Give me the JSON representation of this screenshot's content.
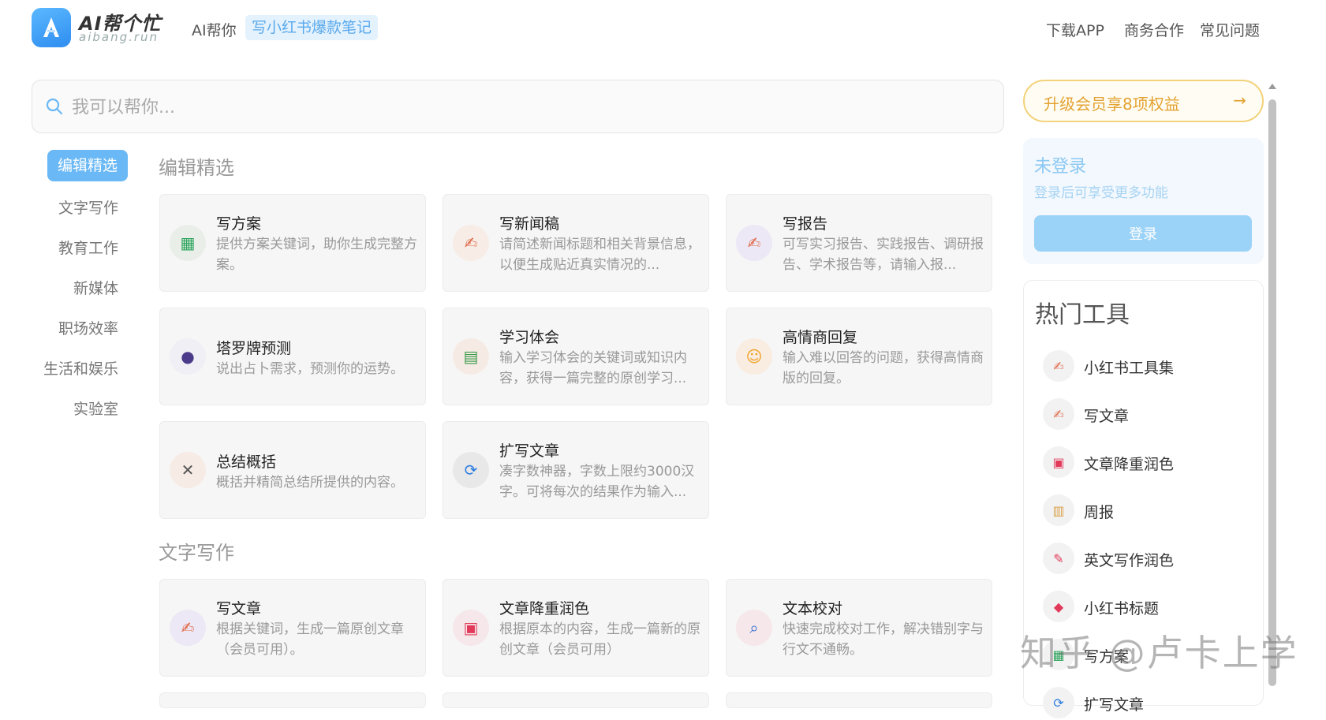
{
  "header": {
    "brand_title": "AI帮个忙",
    "brand_sub": "aibang.run",
    "help_text": "AI帮你",
    "help_tag": "写小红书爆款笔记",
    "nav": [
      "下载APP",
      "商务合作",
      "常见问题"
    ]
  },
  "search": {
    "placeholder": "我可以帮你..."
  },
  "categories": [
    "编辑精选",
    "文字写作",
    "教育工作",
    "新媒体",
    "职场效率",
    "生活和娱乐",
    "实验室"
  ],
  "sections": [
    {
      "title": "编辑精选",
      "cards": [
        {
          "title": "写方案",
          "desc": "提供方案关键词，助你生成完整方案。",
          "icon": "spreadsheet-icon"
        },
        {
          "title": "写新闻稿",
          "desc": "请简述新闻标题和相关背景信息，以便生成贴近真实情况的...",
          "icon": "writing-hand-icon"
        },
        {
          "title": "写报告",
          "desc": "可写实习报告、实践报告、调研报告、学术报告等，请输入报...",
          "icon": "writing-hand-icon"
        },
        {
          "title": "塔罗牌预测",
          "desc": "说出占卜需求，预测你的运势。",
          "icon": "crystal-ball-icon"
        },
        {
          "title": "学习体会",
          "desc": "输入学习体会的关键词或知识内容，获得一篇完整的原创学习...",
          "icon": "books-icon"
        },
        {
          "title": "高情商回复",
          "desc": "输入难以回答的问题，获得高情商版的回复。",
          "icon": "smile-icon"
        },
        {
          "title": "总结概括",
          "desc": "概括并精简总结所提供的内容。",
          "icon": "telescope-icon"
        },
        {
          "title": "扩写文章",
          "desc": "凑字数神器，字数上限约3000汉字。可将每次的结果作为输入...",
          "icon": "refresh-icon"
        }
      ]
    },
    {
      "title": "文字写作",
      "cards": [
        {
          "title": "写文章",
          "desc": "根据关键词，生成一篇原创文章（会员可用）。",
          "icon": "writing-hand-icon"
        },
        {
          "title": "文章降重润色",
          "desc": "根据原本的内容，生成一篇新的原创文章（会员可用）",
          "icon": "stamp-icon"
        },
        {
          "title": "文本校对",
          "desc": "快速完成校对工作，解决错别字与行文不通畅。",
          "icon": "magnifier-icon"
        }
      ]
    }
  ],
  "sidebar": {
    "upgrade_label": "升级会员享8项权益",
    "login_status": "未登录",
    "login_hint": "登录后可享受更多功能",
    "login_button": "登录",
    "hot_title": "热门工具",
    "hot_tools": [
      {
        "label": "小红书工具集",
        "icon": "writing-hand-icon"
      },
      {
        "label": "写文章",
        "icon": "writing-hand-icon"
      },
      {
        "label": "文章降重润色",
        "icon": "stamp-icon"
      },
      {
        "label": "周报",
        "icon": "scroll-icon"
      },
      {
        "label": "英文写作润色",
        "icon": "pencil-icon"
      },
      {
        "label": "小红书标题",
        "icon": "tag-icon"
      },
      {
        "label": "写方案",
        "icon": "spreadsheet-icon"
      },
      {
        "label": "扩写文章",
        "icon": "refresh-icon"
      }
    ]
  },
  "watermark": "知乎 @卢卡上学"
}
